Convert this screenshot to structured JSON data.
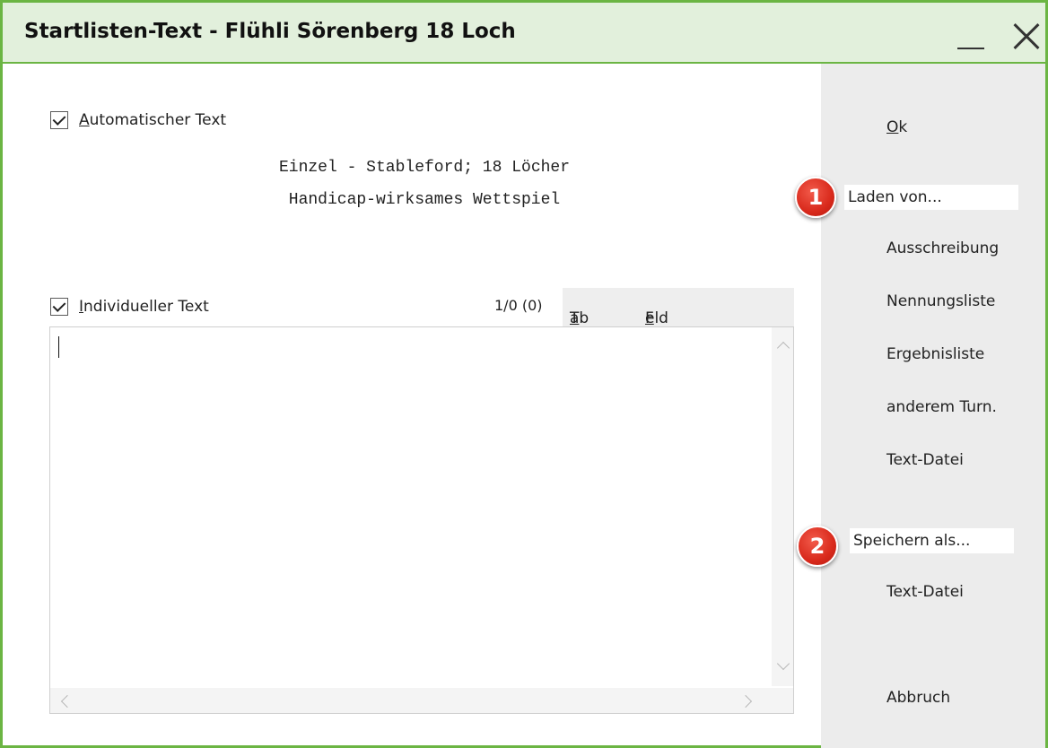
{
  "window": {
    "title": "Startlisten-Text - Flühli Sörenberg 18 Loch"
  },
  "auto_text": {
    "label_access": "A",
    "label_rest": "utomatischer Text",
    "checked": true,
    "lines": [
      "Einzel - Stableford; 18 Löcher",
      "Handicap-wirksames Wettspiel"
    ]
  },
  "individual_text": {
    "label_access": "I",
    "label_rest": "ndividueller Text",
    "checked": true,
    "counter": "1/0 (0)",
    "value": ""
  },
  "tabbar": {
    "tab_access": "T",
    "tab_rest": "ab ->",
    "field_access": "F",
    "field_rest": "eld einfügen"
  },
  "actions": {
    "ok_access": "O",
    "ok_rest": "k",
    "load_label": "Laden von...",
    "load_items": [
      "Ausschreibung",
      "Nennungsliste",
      "Ergebnisliste",
      "anderem Turn.",
      "Text-Datei"
    ],
    "save_label": "Speichern als...",
    "save_items": [
      "Text-Datei"
    ],
    "cancel": "Abbruch"
  },
  "badges": [
    "1",
    "2"
  ],
  "colors": {
    "title_bar": "#e2f0dc",
    "window_border": "#6bb543",
    "side_panel": "#ececec",
    "badge": "#d92a1c"
  },
  "icons": [
    "minimize-icon",
    "close-icon",
    "checkbox-checked-icon",
    "scroll-arrow-icon"
  ]
}
